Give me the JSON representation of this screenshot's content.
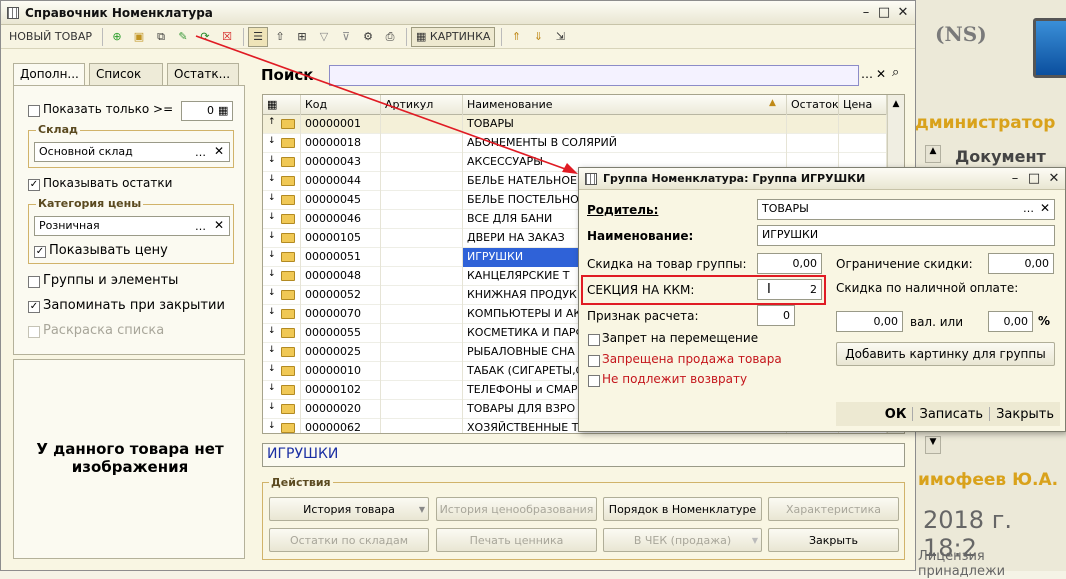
{
  "main_window": {
    "title": "Справочник Номенклатура",
    "toolbar": {
      "new_item_label": "НОВЫЙ ТОВАР",
      "picture_label": "КАРТИНКА"
    },
    "tabs": [
      "Дополн...",
      "Список ...",
      "Остатк..."
    ],
    "filters": {
      "show_only_label": "Показать только >=",
      "show_only_value": "0",
      "warehouse_group": "Склад",
      "warehouse_value": "Основной склад",
      "show_stock_label": "Показывать остатки",
      "price_category_group": "Категория цены",
      "price_category_value": "Розничная",
      "show_price_label": "Показывать цену",
      "groups_elements_label": "Группы и элементы",
      "remember_label": "Запоминать при закрытии",
      "coloring_label": "Раскраска списка"
    },
    "no_image_text": "У данного товара нет изображения",
    "search_label": "Поиск",
    "search_value": "",
    "grid": {
      "columns": [
        "Код",
        "Артикул",
        "Наименование",
        "Остаток",
        "Цена"
      ],
      "rows": [
        {
          "code": "00000001",
          "article": "",
          "name": "ТОВАРЫ",
          "selected": false,
          "top": true
        },
        {
          "code": "00000018",
          "article": "",
          "name": "АБОНЕМЕНТЫ В СОЛЯРИЙ",
          "selected": false
        },
        {
          "code": "00000043",
          "article": "",
          "name": "АКСЕССУАРЫ",
          "selected": false
        },
        {
          "code": "00000044",
          "article": "",
          "name": "БЕЛЬЕ НАТЕЛЬНОЕ",
          "selected": false
        },
        {
          "code": "00000045",
          "article": "",
          "name": "БЕЛЬЕ ПОСТЕЛЬНО",
          "selected": false
        },
        {
          "code": "00000046",
          "article": "",
          "name": "ВСЕ ДЛЯ БАНИ",
          "selected": false
        },
        {
          "code": "00000105",
          "article": "",
          "name": "ДВЕРИ НА ЗАКАЗ",
          "selected": false
        },
        {
          "code": "00000051",
          "article": "",
          "name": "ИГРУШКИ",
          "selected": true
        },
        {
          "code": "00000048",
          "article": "",
          "name": "КАНЦЕЛЯРСКИЕ Т",
          "selected": false
        },
        {
          "code": "00000052",
          "article": "",
          "name": "КНИЖНАЯ ПРОДУК",
          "selected": false
        },
        {
          "code": "00000070",
          "article": "",
          "name": "КОМПЬЮТЕРЫ И АКС",
          "selected": false
        },
        {
          "code": "00000055",
          "article": "",
          "name": "КОСМЕТИКА И ПАРФ",
          "selected": false
        },
        {
          "code": "00000025",
          "article": "",
          "name": "РЫБАЛОВНЫЕ СНА",
          "selected": false
        },
        {
          "code": "00000010",
          "article": "",
          "name": "ТАБАК (СИГАРЕТЫ,С",
          "selected": false
        },
        {
          "code": "00000102",
          "article": "",
          "name": "ТЕЛЕФОНЫ и СМАР",
          "selected": false
        },
        {
          "code": "00000020",
          "article": "",
          "name": "ТОВАРЫ ДЛЯ ВЗРО",
          "selected": false
        },
        {
          "code": "00000062",
          "article": "",
          "name": "ХОЗЯЙСТВЕННЫЕ Т",
          "selected": false
        }
      ]
    },
    "current_item": "ИГРУШКИ",
    "actions": {
      "group_title": "Действия",
      "history": "История товара",
      "pricing_history": "История ценообразования",
      "order": "Порядок в Номенклатуре",
      "characteristic": "Характеристика",
      "stock_by_warehouse": "Остатки по складам",
      "print_tag": "Печать ценника",
      "to_check": "В ЧЕК (продажа)",
      "close": "Закрыть"
    }
  },
  "dialog": {
    "title": "Группа Номенклатура: Группа ИГРУШКИ",
    "parent_label": "Родитель:",
    "parent_value": "ТОВАРЫ",
    "name_label": "Наименование:",
    "name_value": "ИГРУШКИ",
    "discount_label": "Скидка на товар группы:",
    "discount_value": "0,00",
    "section_label": "СЕКЦИЯ НА ККМ:",
    "section_value": "2",
    "calc_sign_label": "Признак расчета:",
    "calc_sign_value": "0",
    "discount_limit_label": "Ограничение скидки:",
    "discount_limit_value": "0,00",
    "cash_discount_label": "Скидка по наличной оплате:",
    "cash_discount_value": "0,00",
    "val_or_label": "вал. или",
    "percent_value": "0,00",
    "percent_sign": "%",
    "no_move_label": "Запрет на перемещение",
    "no_sale_label": "Запрещена продажа товара",
    "no_return_label": "Не подлежит возврату",
    "add_picture_button": "Добавить картинку для группы",
    "ok": "ОК",
    "save": "Записать",
    "close": "Закрыть"
  },
  "background": {
    "ns_label": "(NS)",
    "admin_label": "дминистратор",
    "documents_label": "Документ",
    "user_label": "имофеев Ю.А.",
    "date_label": "2018 г. 18:2",
    "license_label": "Лицензия принадлежи"
  },
  "colors": {
    "selection": "#2f62d8",
    "highlight_border": "#e01b24",
    "arrow": "#e01b24"
  }
}
